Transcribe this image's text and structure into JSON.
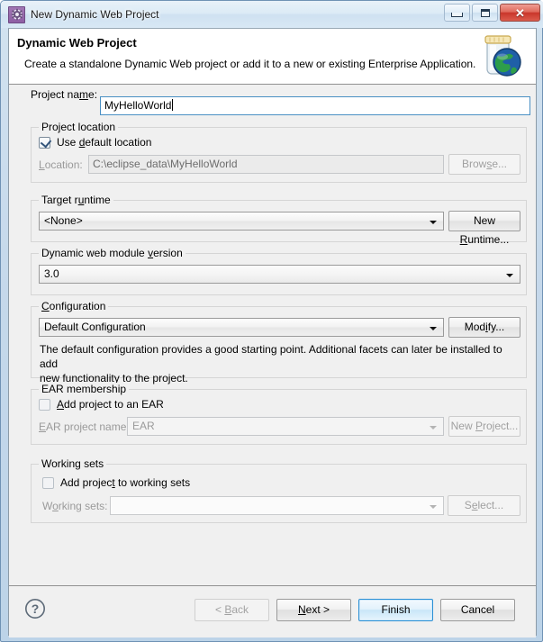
{
  "window": {
    "title": "New Dynamic Web Project",
    "icon": "gear-icon",
    "minimize_label": "Minimize",
    "maximize_label": "Maximize",
    "close_label": "Close"
  },
  "header": {
    "title": "Dynamic Web Project",
    "description": "Create a standalone Dynamic Web project or add it to a new or existing Enterprise Application.",
    "banner_icon": "jar-globe-icon"
  },
  "form": {
    "project_name_label": "Project name:",
    "project_name_mnemonic_before": "Project na",
    "project_name_mnemonic": "m",
    "project_name_mnemonic_after": "e:",
    "project_name_value": "MyHelloWorld",
    "project_name_placeholder": ""
  },
  "project_location": {
    "group_label": "Project location",
    "use_default_checkbox_label": "Use default location",
    "use_default_checkbox_before": "Use ",
    "use_default_checkbox_mnemonic": "d",
    "use_default_checkbox_after": "efault location",
    "use_default_checked": true,
    "location_label": "Location:",
    "location_label_mnemonic": "L",
    "location_label_after": "ocation:",
    "location_value": "C:\\eclipse_data\\MyHelloWorld",
    "browse_button": "Browse...",
    "browse_button_before": "Brow",
    "browse_button_mnemonic": "s",
    "browse_button_after": "e...",
    "disabled": true
  },
  "target_runtime": {
    "group_label": "Target runtime",
    "group_label_before": "Target r",
    "group_label_mnemonic": "u",
    "group_label_after": "ntime",
    "selected": "<None>",
    "new_runtime_button": "New Runtime...",
    "new_runtime_before": "New ",
    "new_runtime_mnemonic": "R",
    "new_runtime_after": "untime..."
  },
  "module_version": {
    "group_label": "Dynamic web module version",
    "group_label_before": "Dynamic web module ",
    "group_label_mnemonic": "v",
    "group_label_after": "ersion",
    "selected": "3.0"
  },
  "configuration": {
    "group_label": "Configuration",
    "group_label_mnemonic": "C",
    "group_label_after": "onfiguration",
    "selected": "Default Configuration",
    "modify_button": "Modify...",
    "modify_before": "Mod",
    "modify_mnemonic": "i",
    "modify_after": "fy...",
    "description_line1": "The default configuration provides a good starting point. Additional facets can later be installed to add",
    "description_line2": "new functionality to the project."
  },
  "ear_membership": {
    "group_label": "EAR membership",
    "add_checkbox_label": "Add project to an EAR",
    "add_checkbox_mnemonic": "A",
    "add_checkbox_after": "dd project to an EAR",
    "add_checked": false,
    "ear_name_label": "EAR project name:",
    "ear_name_mnemonic": "E",
    "ear_name_after": "AR project name:",
    "ear_name_value": "EAR",
    "new_project_button": "New Project...",
    "new_project_before": "New ",
    "new_project_mnemonic": "P",
    "new_project_after": "roject...",
    "disabled": true
  },
  "working_sets": {
    "group_label": "Working sets",
    "add_checkbox_label": "Add project to working sets",
    "add_checkbox_before": "Add projec",
    "add_checkbox_mnemonic": "t",
    "add_checkbox_after": " to working sets",
    "add_checked": false,
    "working_sets_label": "Working sets:",
    "working_sets_label_before": "W",
    "working_sets_label_mnemonic": "o",
    "working_sets_label_after": "rking sets:",
    "working_sets_value": "",
    "select_button": "Select...",
    "select_before": "S",
    "select_mnemonic": "e",
    "select_after": "lect...",
    "disabled": true
  },
  "buttons": {
    "help": "?",
    "back": "< Back",
    "back_before": "< ",
    "back_mnemonic": "B",
    "back_after": "ack",
    "back_disabled": true,
    "next": "Next >",
    "next_mnemonic": "N",
    "next_after": "ext >",
    "finish": "Finish",
    "finish_default": true,
    "cancel": "Cancel"
  },
  "colors": {
    "frame": "#bcd3e8",
    "dialog_bg": "#f0f0f0",
    "header_bg": "#ffffff",
    "focus_border": "#4a90c4",
    "default_button_border": "#2a8fd4",
    "close_button": "#c9362b",
    "disabled_text": "#9a9a9a"
  }
}
